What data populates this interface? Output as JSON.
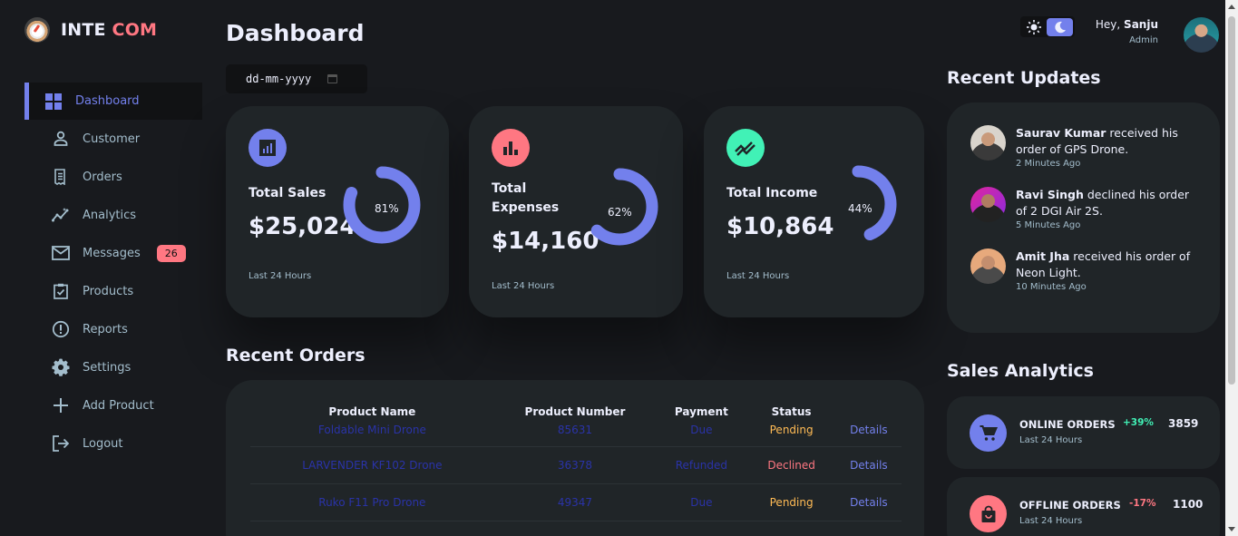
{
  "brand": {
    "name_part1": "INTE",
    "name_part2": "COM"
  },
  "sidebar": {
    "items": [
      {
        "label": "Dashboard",
        "icon": "grid-icon",
        "active": true
      },
      {
        "label": "Customer",
        "icon": "person-icon"
      },
      {
        "label": "Orders",
        "icon": "receipt-icon"
      },
      {
        "label": "Analytics",
        "icon": "insights-icon"
      },
      {
        "label": "Messages",
        "icon": "mail-icon",
        "badge": "26"
      },
      {
        "label": "Products",
        "icon": "inventory-icon"
      },
      {
        "label": "Reports",
        "icon": "report-icon"
      },
      {
        "label": "Settings",
        "icon": "gear-icon"
      },
      {
        "label": "Add Product",
        "icon": "add-icon"
      },
      {
        "label": "Logout",
        "icon": "logout-icon"
      }
    ]
  },
  "header": {
    "title": "Dashboard",
    "date_placeholder": "dd-mm-yyyy",
    "greeting": "Hey,",
    "user_name": "Sanju",
    "user_role": "Admin"
  },
  "insights": [
    {
      "title": "Total Sales",
      "value": "$25,024",
      "percent": "81%",
      "percent_value": 81,
      "footer": "Last 24 Hours",
      "icon": "analytics-icon",
      "icon_color": "#7380ec"
    },
    {
      "title": "Total Expenses",
      "value": "$14,160",
      "percent": "62%",
      "percent_value": 62,
      "footer": "Last 24 Hours",
      "icon": "bar-chart-icon",
      "icon_color": "#ff7782"
    },
    {
      "title": "Total Income",
      "value": "$10,864",
      "percent": "44%",
      "percent_value": 44,
      "footer": "Last 24 Hours",
      "icon": "stocks-icon",
      "icon_color": "#41f1b6"
    }
  ],
  "recent_orders": {
    "title": "Recent Orders",
    "columns": [
      "Product Name",
      "Product Number",
      "Payment",
      "Status",
      ""
    ],
    "rows": [
      {
        "name": "Foldable Mini Drone",
        "number": "85631",
        "payment": "Due",
        "status": "Pending",
        "action": "Details"
      },
      {
        "name": "LARVENDER KF102 Drone",
        "number": "36378",
        "payment": "Refunded",
        "status": "Declined",
        "action": "Details"
      },
      {
        "name": "Ruko F11 Pro Drone",
        "number": "49347",
        "payment": "Due",
        "status": "Pending",
        "action": "Details"
      }
    ]
  },
  "recent_updates": {
    "title": "Recent Updates",
    "items": [
      {
        "name": "Saurav Kumar",
        "text": "received his order of GPS Drone.",
        "time": "2 Minutes Ago"
      },
      {
        "name": "Ravi Singh",
        "text": "declined his order of 2 DGI Air 2S.",
        "time": "5 Minutes Ago"
      },
      {
        "name": "Amit Jha",
        "text": "received his order of Neon Light.",
        "time": "10 Minutes Ago"
      }
    ]
  },
  "sales_analytics": {
    "title": "Sales Analytics",
    "items": [
      {
        "title": "ONLINE ORDERS",
        "footer": "Last 24 Hours",
        "change": "+39%",
        "count": "3859",
        "icon": "cart-icon",
        "color": "#7380ec",
        "change_color": "#41f1b6"
      },
      {
        "title": "OFFLINE ORDERS",
        "footer": "Last 24 Hours",
        "change": "-17%",
        "count": "1100",
        "icon": "shopping-bag-icon",
        "color": "#ff7782",
        "change_color": "#ff7782"
      }
    ]
  }
}
